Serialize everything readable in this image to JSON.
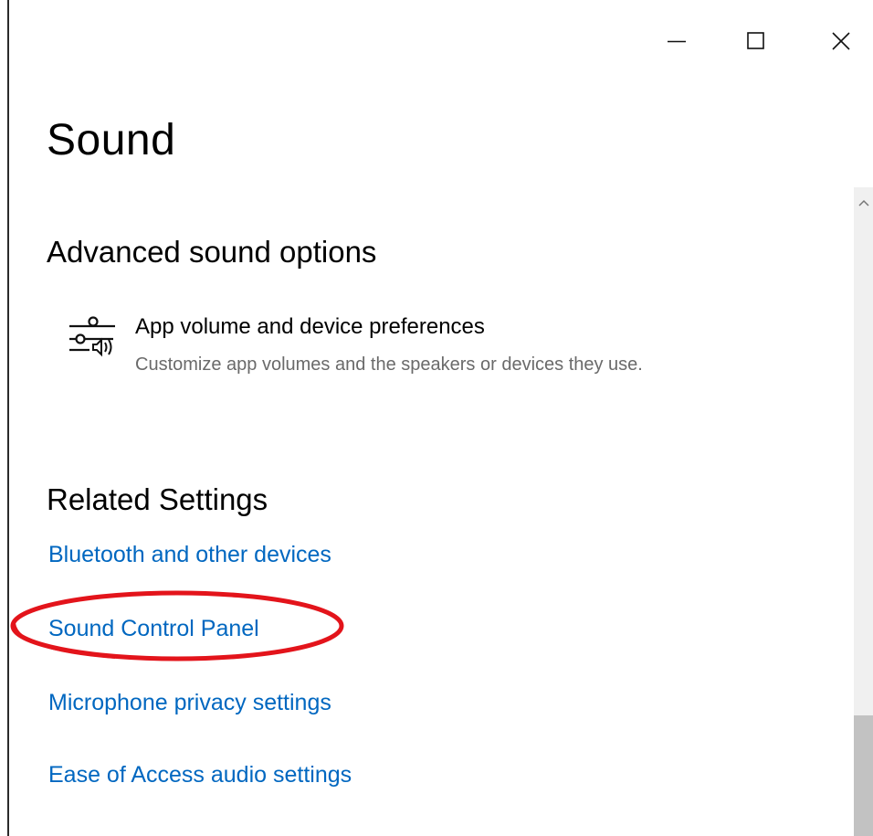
{
  "window": {
    "controls": [
      "minimize",
      "maximize",
      "close"
    ]
  },
  "page": {
    "title": "Sound"
  },
  "advanced": {
    "heading": "Advanced sound options",
    "item": {
      "icon": "mixer-icon",
      "title": "App volume and device preferences",
      "description": "Customize app volumes and the speakers or devices they use."
    }
  },
  "related": {
    "heading": "Related Settings",
    "links": [
      "Bluetooth and other devices",
      "Sound Control Panel",
      "Microphone privacy settings",
      "Ease of Access audio settings"
    ]
  },
  "annotation": {
    "highlight_color": "#e3141b",
    "highlighted_link": "Sound Control Panel"
  },
  "colors": {
    "link": "#0067c0",
    "secondary_text": "#6a6a6a",
    "scroll_track": "#f0f0f0",
    "scroll_thumb": "#c2c2c2"
  }
}
